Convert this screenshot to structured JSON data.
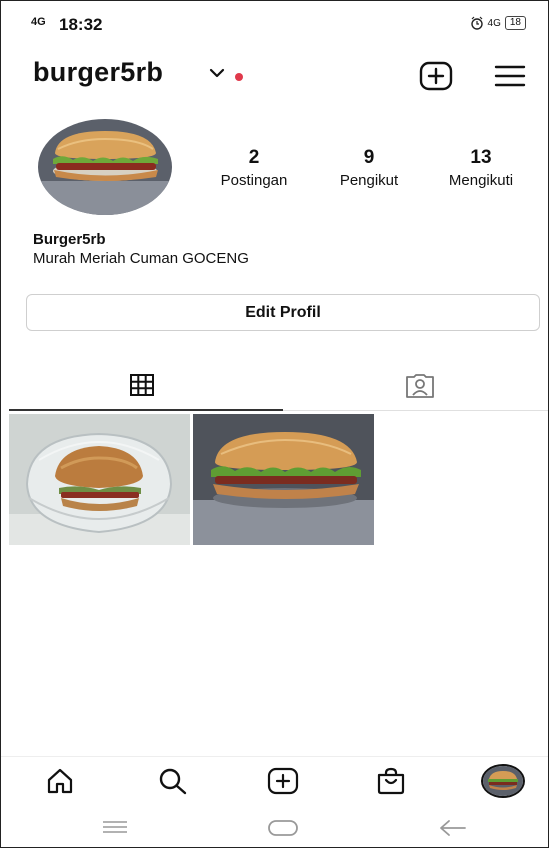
{
  "status_bar": {
    "network": "4G",
    "time": "18:32",
    "right_network": "4G",
    "battery": "18"
  },
  "header": {
    "username": "burger5rb",
    "notification_dot_color": "#e0394b"
  },
  "profile": {
    "stats": [
      {
        "count": "2",
        "label": "Postingan"
      },
      {
        "count": "9",
        "label": "Pengikut"
      },
      {
        "count": "13",
        "label": "Mengikuti"
      }
    ],
    "name": "Burger5rb",
    "bio": "Murah Meriah Cuman GOCENG",
    "edit_button": "Edit Profil"
  },
  "tabs": [
    {
      "icon": "grid-icon",
      "active": true
    },
    {
      "icon": "tagged-person-icon",
      "active": false
    }
  ],
  "posts": [
    {
      "subject": "burger in plastic container"
    },
    {
      "subject": "burger on table"
    }
  ],
  "bottom_nav": [
    "home-icon",
    "search-icon",
    "add-post-icon",
    "shop-icon",
    "profile-avatar"
  ],
  "system_nav": [
    "menu-icon",
    "home-pill-icon",
    "back-icon"
  ]
}
